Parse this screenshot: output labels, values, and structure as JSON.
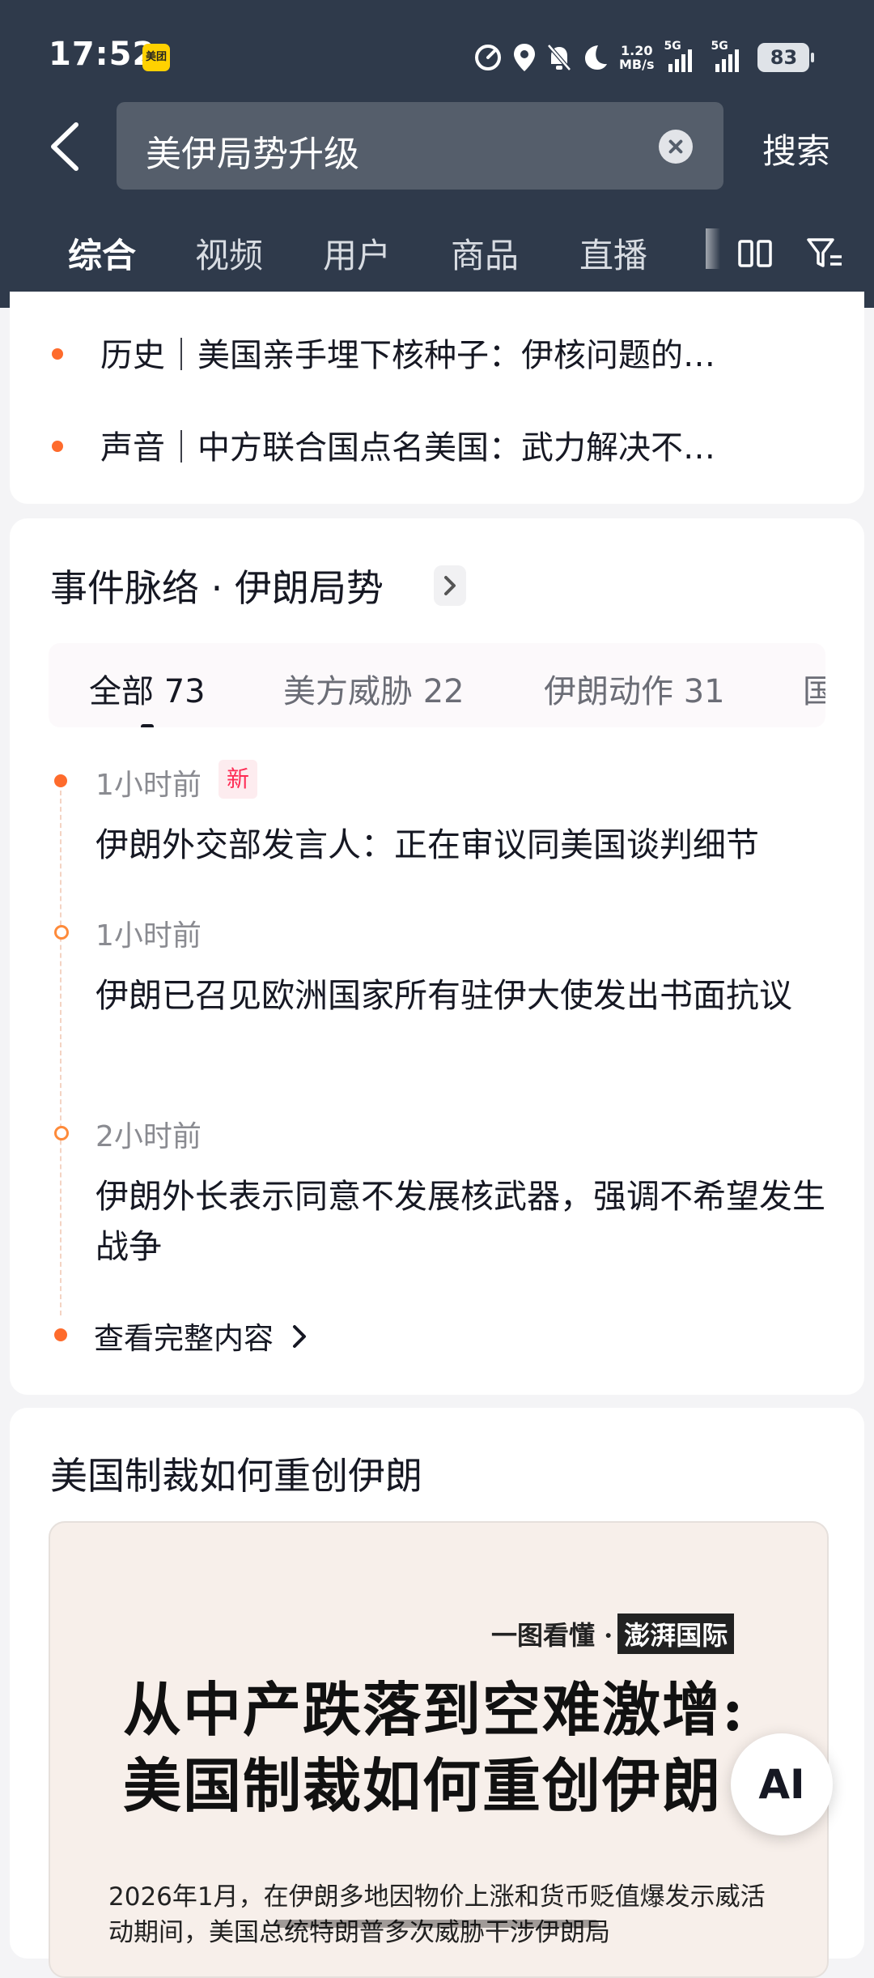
{
  "status_bar": {
    "time": "17:52",
    "app_badge": "美团",
    "net_speed_value": "1.20",
    "net_speed_unit": "MB/s",
    "signal_label_1": "5G",
    "signal_label_2": "5G",
    "battery": "83"
  },
  "header": {
    "query": "美伊局势升级",
    "search_label": "搜索"
  },
  "tabs": [
    "综合",
    "视频",
    "用户",
    "商品",
    "直播"
  ],
  "related_links": [
    "历史｜美国亲手埋下核种子：伊核问题的…",
    "声音｜中方联合国点名美国：武力解决不…"
  ],
  "timeline": {
    "title": "事件脉络 · 伊朗局势",
    "filters": [
      {
        "label": "全部 73"
      },
      {
        "label": "美方威胁 22"
      },
      {
        "label": "伊朗动作 31"
      },
      {
        "label": "国"
      }
    ],
    "events": [
      {
        "time": "1小时前",
        "badge": "新",
        "text": "伊朗外交部发言人：正在审议同美国谈判细节"
      },
      {
        "time": "1小时前",
        "text": "伊朗已召见欧洲国家所有驻伊大使发出书面抗议"
      },
      {
        "time": "2小时前",
        "text": "伊朗外长表示同意不发展核武器，强调不希望发生战争"
      }
    ],
    "more_label": "查看完整内容"
  },
  "article": {
    "title": "美国制裁如何重创伊朗",
    "image": {
      "brand_prefix": "一图看懂 ·",
      "brand_name": "澎湃国际",
      "headline_1": "从中产跌落到空难激增:",
      "headline_2": "美国制裁如何重创伊朗",
      "body": "2026年1月，在伊朗多地因物价上涨和货币贬值爆发示威活动期间，美国总统特朗普多次威胁干涉伊朗局"
    }
  },
  "ai_button": "AI",
  "colors": {
    "header_bg": "#2f3a4b",
    "accent_orange": "#fe6b2c",
    "new_badge": "#fe2c55"
  }
}
